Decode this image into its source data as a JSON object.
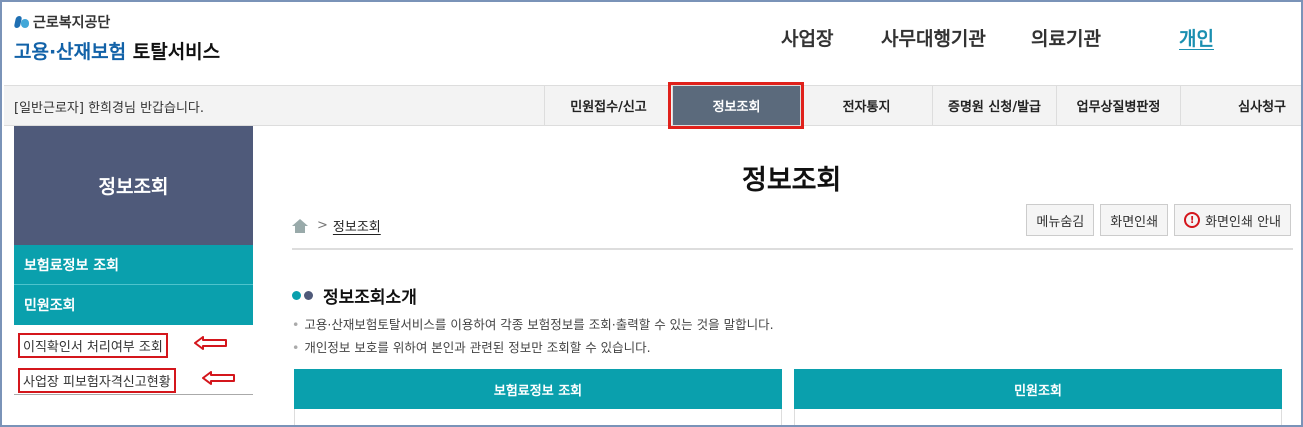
{
  "header": {
    "org_name": "근로복지공단",
    "service_name_part1": "고용·산재보험",
    "service_name_part2": "토탈서비스",
    "topnav": [
      "사업장",
      "사무대행기관",
      "의료기관",
      "개인"
    ]
  },
  "navbar": {
    "user_type": "[일반근로자]",
    "user_name": "한희경",
    "greeting_suffix": "님 반갑습니다.",
    "menu": [
      "민원접수/신고",
      "정보조회",
      "전자통지",
      "증명원 신청/발급",
      "업무상질병판정",
      "심사청구"
    ],
    "active_menu": "정보조회"
  },
  "sidebar": {
    "title": "정보조회",
    "items": [
      "보험료정보 조회",
      "민원조회"
    ],
    "subitems": [
      "이직확인서 처리여부 조회",
      "사업장 피보험자격신고현황"
    ]
  },
  "main": {
    "title": "정보조회",
    "breadcrumb_sep": ">",
    "breadcrumb_current": "정보조회",
    "buttons": {
      "hide_menu": "메뉴숨김",
      "print": "화면인쇄",
      "print_guide": "화면인쇄 안내"
    },
    "section_title": "정보조회소개",
    "descriptions": [
      "고용·산재보험토탈서비스를 이용하여 각종 보험정보를 조회·출력할 수 있는 것을 말합니다.",
      "개인정보 보호를 위하여 본인과 관련된 정보만 조회할 수 있습니다."
    ],
    "tabs": [
      "보험료정보 조회",
      "민원조회"
    ]
  },
  "colors": {
    "accent_teal": "#0aa0ad",
    "sidebar_header": "#4f5a7a",
    "active_menu_bg": "#5b6a7c",
    "highlight_red": "#e0211b"
  }
}
